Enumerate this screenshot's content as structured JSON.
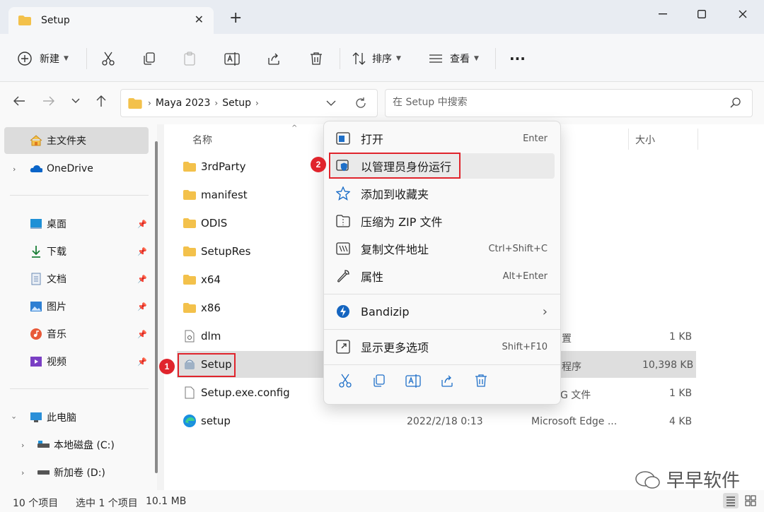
{
  "window": {
    "tab_title": "Setup",
    "new_tab": "+",
    "minimize": "—",
    "maximize": "☐",
    "close": "✕"
  },
  "toolbar": {
    "new_label": "新建",
    "sort_label": "排序",
    "view_label": "查看",
    "more_label": "···"
  },
  "address": {
    "crumbs": [
      "Maya 2023",
      "Setup"
    ],
    "search_placeholder": "在 Setup 中搜索"
  },
  "sidebar": {
    "items": [
      {
        "label": "主文件夹",
        "icon": "home-icon"
      },
      {
        "label": "OneDrive",
        "icon": "cloud-icon"
      },
      {
        "label": "桌面",
        "icon": "desktop-icon"
      },
      {
        "label": "下载",
        "icon": "download-icon"
      },
      {
        "label": "文档",
        "icon": "document-icon"
      },
      {
        "label": "图片",
        "icon": "pictures-icon"
      },
      {
        "label": "音乐",
        "icon": "music-icon"
      },
      {
        "label": "视频",
        "icon": "video-icon"
      },
      {
        "label": "此电脑",
        "icon": "computer-icon"
      },
      {
        "label": "本地磁盘 (C:)",
        "icon": "drive-icon"
      },
      {
        "label": "新加卷 (D:)",
        "icon": "drive-icon"
      }
    ]
  },
  "columns": {
    "name": "名称",
    "size": "大小"
  },
  "files": [
    {
      "name": "3rdParty",
      "type_frag": "",
      "size": "",
      "date": ""
    },
    {
      "name": "manifest",
      "type_frag": "",
      "size": "",
      "date": ""
    },
    {
      "name": "ODIS",
      "type_frag": "",
      "size": "",
      "date": ""
    },
    {
      "name": "SetupRes",
      "type_frag": "",
      "size": "",
      "date": ""
    },
    {
      "name": "x64",
      "type_frag": "",
      "size": "",
      "date": ""
    },
    {
      "name": "x86",
      "type_frag": "",
      "size": "",
      "date": ""
    },
    {
      "name": "dlm",
      "type_frag": "置",
      "size": "1 KB",
      "date": ""
    },
    {
      "name": "Setup",
      "type_frag": "程序",
      "size": "10,398 KB",
      "date": ""
    },
    {
      "name": "Setup.exe.config",
      "type_frag": "G 文件",
      "size": "1 KB",
      "date": ""
    },
    {
      "name": "setup",
      "type_frag": "Microsoft Edge ...",
      "size": "4 KB",
      "date": "2022/2/18 0:13"
    }
  ],
  "context_menu": {
    "items": [
      {
        "label": "打开",
        "shortcut": "Enter",
        "icon": "open-icon"
      },
      {
        "label": "以管理员身份运行",
        "shortcut": "",
        "icon": "admin-shield-icon"
      },
      {
        "label": "添加到收藏夹",
        "shortcut": "",
        "icon": "star-icon"
      },
      {
        "label": "压缩为 ZIP 文件",
        "shortcut": "",
        "icon": "zip-icon"
      },
      {
        "label": "复制文件地址",
        "shortcut": "Ctrl+Shift+C",
        "icon": "copy-path-icon"
      },
      {
        "label": "属性",
        "shortcut": "Alt+Enter",
        "icon": "wrench-icon"
      },
      {
        "label": "Bandizip",
        "shortcut": "›",
        "icon": "bandizip-icon"
      },
      {
        "label": "显示更多选项",
        "shortcut": "Shift+F10",
        "icon": "more-options-icon"
      }
    ]
  },
  "status": {
    "count": "10 个项目",
    "selected": "选中 1 个项目",
    "size": "10.1 MB"
  },
  "annotations": {
    "badge1": "1",
    "badge2": "2"
  },
  "watermark": "早早软件",
  "colors": {
    "accent": "#0067c0",
    "folder": "#f3c14b",
    "highlight": "#e0242c"
  }
}
